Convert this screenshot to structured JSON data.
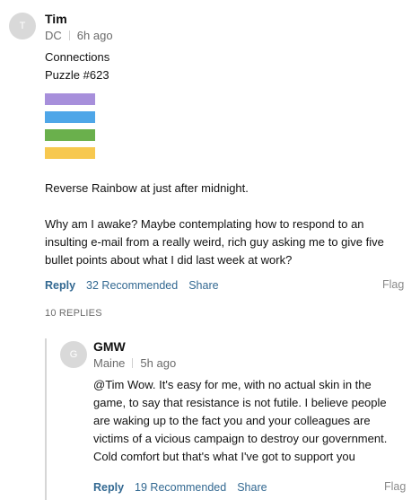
{
  "comment": {
    "avatar_letter": "T",
    "author": "Tim",
    "location": "DC",
    "time": "6h ago",
    "lines_top": [
      "Connections",
      "Puzzle #623"
    ],
    "squares": [
      {
        "color": "#a78fdb",
        "count": 4
      },
      {
        "color": "#4ea6e8",
        "count": 4
      },
      {
        "color": "#6ab04c",
        "count": 4
      },
      {
        "color": "#f7c84f",
        "count": 4
      }
    ],
    "paragraph_1": "Reverse Rainbow at just after midnight.",
    "paragraph_2": "Why am I awake?  Maybe contemplating how to respond to an insulting e-mail from a really weird, rich guy asking me to give five bullet points about what I did last week at work?",
    "reply_label": "Reply",
    "recommended_label": "32 Recommended",
    "share_label": "Share",
    "flag_label": "Flag",
    "replies_count": "10 REPLIES"
  },
  "reply": {
    "avatar_letter": "G",
    "author": "GMW",
    "location": "Maine",
    "time": "5h ago",
    "text": "@Tim Wow. It's easy for me, with no actual skin in the game, to say that resistance is not futile. I believe people are waking up to the fact you and your colleagues are victims of a vicious campaign to destroy our government. Cold comfort but that's what I've got to support you",
    "reply_label": "Reply",
    "recommended_label": "19 Recommended",
    "share_label": "Share",
    "flag_label": "Flag"
  }
}
